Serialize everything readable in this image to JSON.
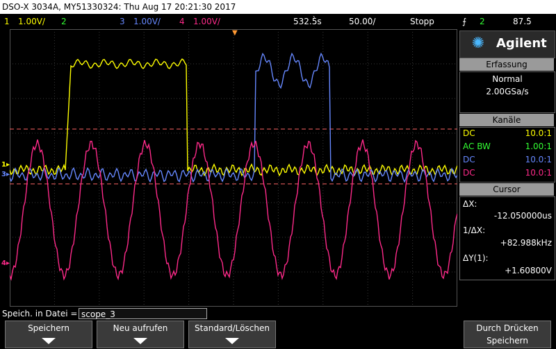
{
  "title": "DSO-X 3034A, MY51330324: Thu Aug 17 20:21:30 2017",
  "status": {
    "ch1_num": "1",
    "ch1_scale": "1.00V/",
    "ch2_num": "2",
    "ch3_num": "3",
    "ch3_scale": "1.00V/",
    "ch4_num": "4",
    "ch4_scale": "1.00V/",
    "timebase": "532.5̀s",
    "timescale": "50.00̀/",
    "run_state": "Stopp",
    "trigger_ch": "2",
    "trigger_level": "87.5̀"
  },
  "brand": "Agilent",
  "acquisition": {
    "header": "Erfassung",
    "mode": "Normal",
    "rate": "2.00GSa/s"
  },
  "channels": {
    "header": "Kanäle",
    "rows": [
      {
        "coupling": "DC",
        "probe": "10.0:1",
        "color": "#ffff00"
      },
      {
        "coupling": "AC BW",
        "probe": "1.00:1",
        "color": "#33ff33"
      },
      {
        "coupling": "DC",
        "probe": "10.0:1",
        "color": "#6688ff"
      },
      {
        "coupling": "DC",
        "probe": "10.0:1",
        "color": "#ff2a8a"
      }
    ]
  },
  "cursor": {
    "header": "Cursor",
    "dx_label": "ΔX:",
    "dx_value": "-12.050000us",
    "inv_dx_label": "1/ΔX:",
    "inv_dx_value": "+82.988kHz",
    "dy_label": "ΔY(1):",
    "dy_value": "+1.60800V"
  },
  "save": {
    "label": "Speich. in Datei =",
    "filename": "scope_3"
  },
  "softkeys": [
    {
      "label": "Speichern"
    },
    {
      "label": "Neu aufrufen"
    },
    {
      "label": "Standard/Löschen"
    },
    {
      "label": "Durch Drücken",
      "label2": "Speichern"
    }
  ],
  "colors": {
    "ch1": "#ffff00",
    "ch2": "#33ff33",
    "ch3": "#6688ff",
    "ch4": "#ff2a8a",
    "grid": "#3a3a3a",
    "cursor": "#ff6666"
  }
}
